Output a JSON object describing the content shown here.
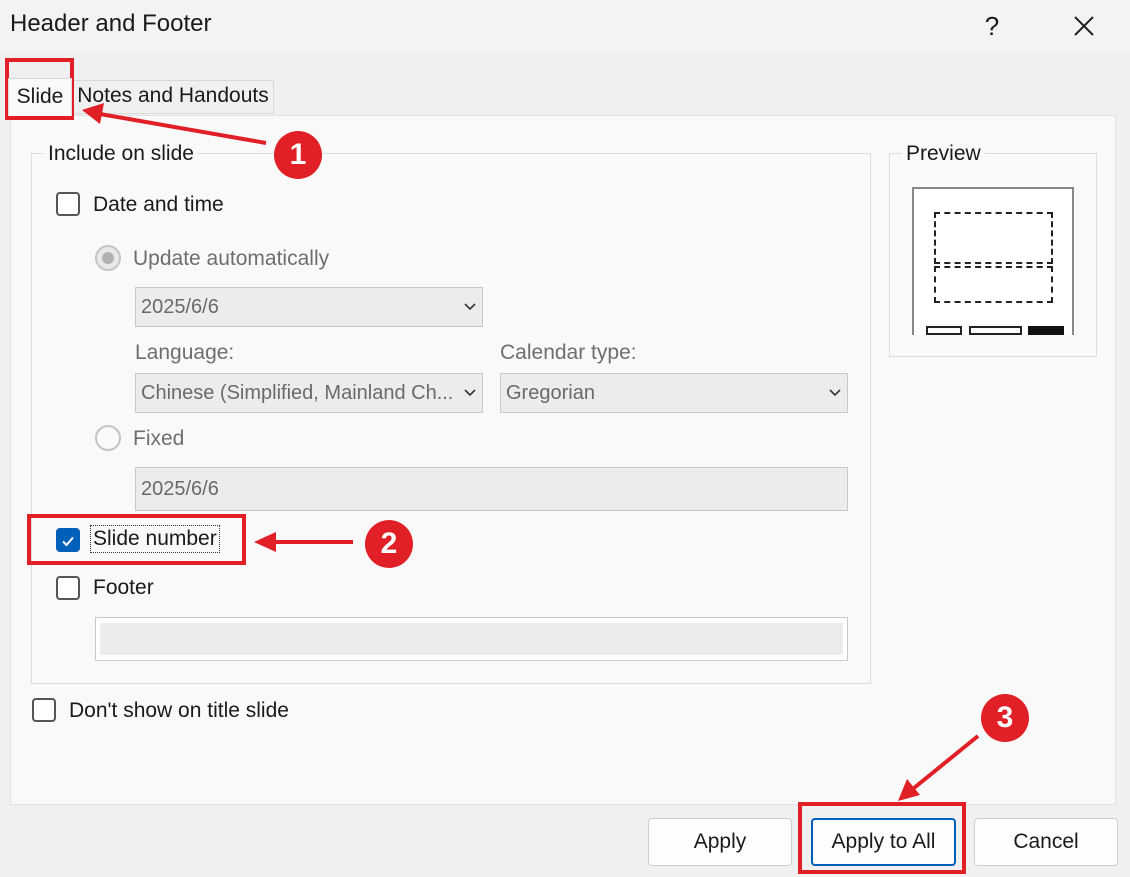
{
  "window": {
    "title": "Header and Footer",
    "help_glyph": "?",
    "close_icon": "close-icon"
  },
  "tabs": [
    {
      "label": "Slide",
      "selected": true
    },
    {
      "label": "Notes and Handouts",
      "selected": false
    }
  ],
  "include_group": {
    "legend": "Include on slide",
    "date_time": {
      "label": "Date and time",
      "checked": false
    },
    "update_auto": {
      "label": "Update automatically",
      "selected": true,
      "enabled": false,
      "value": "2025/6/6"
    },
    "language": {
      "label": "Language:",
      "value": "Chinese (Simplified, Mainland Ch..."
    },
    "calendar": {
      "label": "Calendar type:",
      "value": "Gregorian"
    },
    "fixed": {
      "label": "Fixed",
      "selected": false,
      "value": "2025/6/6"
    },
    "slide_number": {
      "label": "Slide number",
      "checked": true
    },
    "footer": {
      "label": "Footer",
      "checked": false,
      "value": ""
    }
  },
  "dont_show_title": {
    "label": "Don't show on title slide",
    "checked": false
  },
  "preview": {
    "legend": "Preview"
  },
  "buttons": {
    "apply": "Apply",
    "apply_all": "Apply to All",
    "cancel": "Cancel"
  },
  "annotations": [
    {
      "number": "1"
    },
    {
      "number": "2"
    },
    {
      "number": "3"
    }
  ],
  "colors": {
    "accent": "#005fb8",
    "annotation": "#e01f26"
  }
}
